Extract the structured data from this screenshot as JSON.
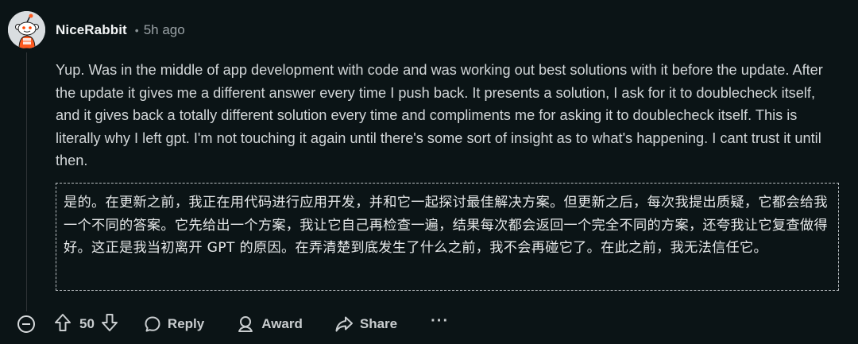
{
  "comment": {
    "username": "NiceRabbit",
    "separator": "•",
    "timestamp": "5h ago",
    "body": "Yup. Was in the middle of app development with code and was working out best solutions with it before the update. After the update it gives me a different answer every time I push back. It presents a solution, I ask for it to doublecheck itself, and it gives back a totally different solution every time and compliments me for asking it to doublecheck itself. This is literally why I left gpt. I'm not touching it again until there's some sort of insight as to what's happening. I cant trust it until then.",
    "translation": "是的。在更新之前，我正在用代码进行应用开发，并和它一起探讨最佳解决方案。但更新之后，每次我提出质疑，它都会给我一个不同的答案。它先给出一个方案，我让它自己再检查一遍，结果每次都会返回一个完全不同的方案，还夸我让它复查做得好。这正是我当初离开 GPT 的原因。在弄清楚到底发生了什么之前，我不会再碰它了。在此之前，我无法信任它。"
  },
  "actions": {
    "vote_count": "50",
    "reply_label": "Reply",
    "award_label": "Award",
    "share_label": "Share",
    "more_label": "···"
  },
  "icons": {
    "collapse": "collapse-icon",
    "upvote": "upvote-icon",
    "downvote": "downvote-icon",
    "reply": "reply-icon",
    "award": "award-icon",
    "share": "share-icon",
    "more": "more-icon"
  },
  "colors": {
    "background": "#0b1416",
    "text": "#d2d6d8",
    "muted": "#9aa2a6",
    "avatar_orange": "#ff5a1f"
  }
}
